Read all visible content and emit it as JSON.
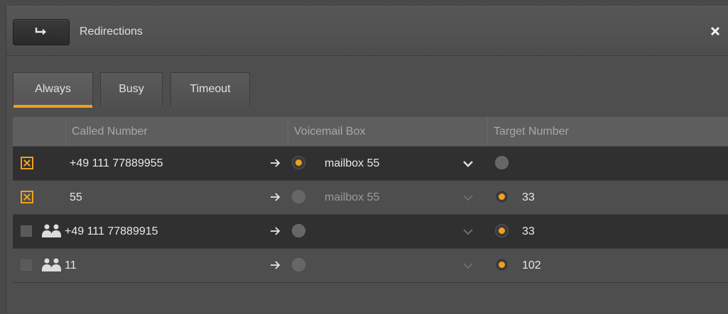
{
  "window": {
    "title": "Redirections",
    "app_icon": "redirect-arrow-icon",
    "close_icon": "close-icon"
  },
  "tabs": [
    {
      "label": "Always",
      "active": true
    },
    {
      "label": "Busy",
      "active": false
    },
    {
      "label": "Timeout",
      "active": false
    }
  ],
  "table": {
    "columns": [
      "",
      "Called Number",
      "Voicemail Box",
      "Target Number"
    ],
    "rows": [
      {
        "enabled": true,
        "group": false,
        "called_number": "+49 111 77889955",
        "voicemail_selected": true,
        "voicemail_box": "mailbox 55",
        "target_selected": false,
        "target_number": ""
      },
      {
        "enabled": true,
        "group": false,
        "called_number": "55",
        "voicemail_selected": false,
        "voicemail_box": "mailbox 55",
        "target_selected": true,
        "target_number": "33"
      },
      {
        "enabled": false,
        "group": true,
        "called_number": "+49 111 77889915",
        "voicemail_selected": false,
        "voicemail_box": "",
        "target_selected": true,
        "target_number": "33"
      },
      {
        "enabled": false,
        "group": true,
        "called_number": "11",
        "voicemail_selected": false,
        "voicemail_box": "",
        "target_selected": true,
        "target_number": "102"
      }
    ]
  },
  "colors": {
    "accent": "#f0a020",
    "background": "#4e4e4e",
    "row_dark": "#303030"
  }
}
